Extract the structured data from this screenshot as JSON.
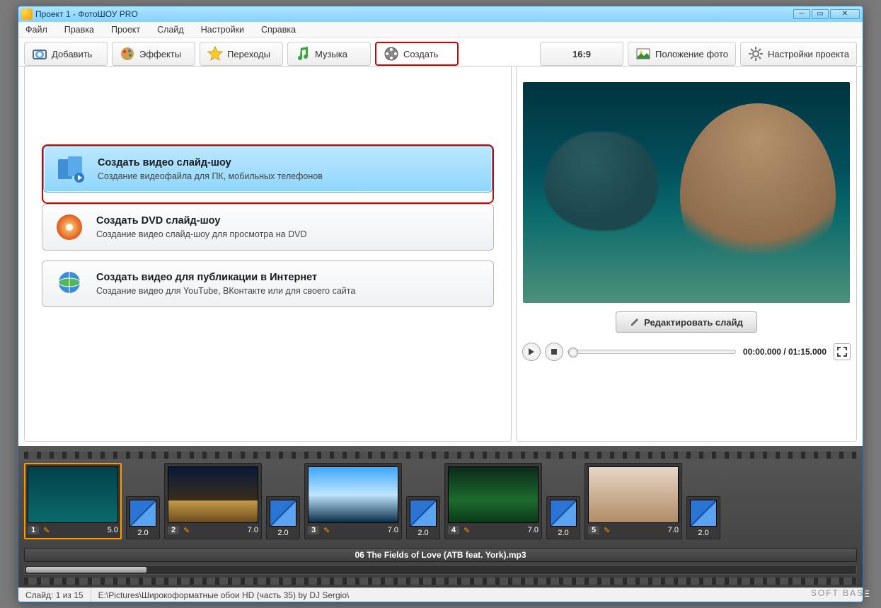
{
  "titlebar": {
    "title": "Проект 1 - ФотоШОУ PRO"
  },
  "menu": [
    "Файл",
    "Правка",
    "Проект",
    "Слайд",
    "Настройки",
    "Справка"
  ],
  "tabs": {
    "add": "Добавить",
    "effects": "Эффекты",
    "transitions": "Переходы",
    "music": "Музыка",
    "create": "Создать"
  },
  "toolbar_right": {
    "aspect": "16:9",
    "photo_position": "Положение фото",
    "project_settings": "Настройки проекта"
  },
  "create_options": [
    {
      "title": "Создать видео слайд-шоу",
      "desc": "Создание видеофайла для ПК, мобильных телефонов"
    },
    {
      "title": "Создать DVD слайд-шоу",
      "desc": "Создание видео слайд-шоу для просмотра на DVD"
    },
    {
      "title": "Создать видео для публикации в Интернет",
      "desc": "Создание видео для YouTube, ВКонтакте или для своего сайта"
    }
  ],
  "preview": {
    "edit_slide": "Редактировать слайд",
    "time": "00:00.000 / 01:15.000"
  },
  "timeline": {
    "slides": [
      {
        "n": "1",
        "dur": "5.0"
      },
      {
        "n": "2",
        "dur": "7.0"
      },
      {
        "n": "3",
        "dur": "7.0"
      },
      {
        "n": "4",
        "dur": "7.0"
      },
      {
        "n": "5",
        "dur": "7.0"
      }
    ],
    "trans_dur": "2.0",
    "audio": "06 The Fields of Love (ATB feat. York).mp3"
  },
  "status": {
    "slide": "Слайд: 1 из 15",
    "path": "E:\\Pictures\\Широкоформатные обои HD (часть 35) by DJ Sergio\\"
  },
  "watermark": "SOFT   BASE"
}
